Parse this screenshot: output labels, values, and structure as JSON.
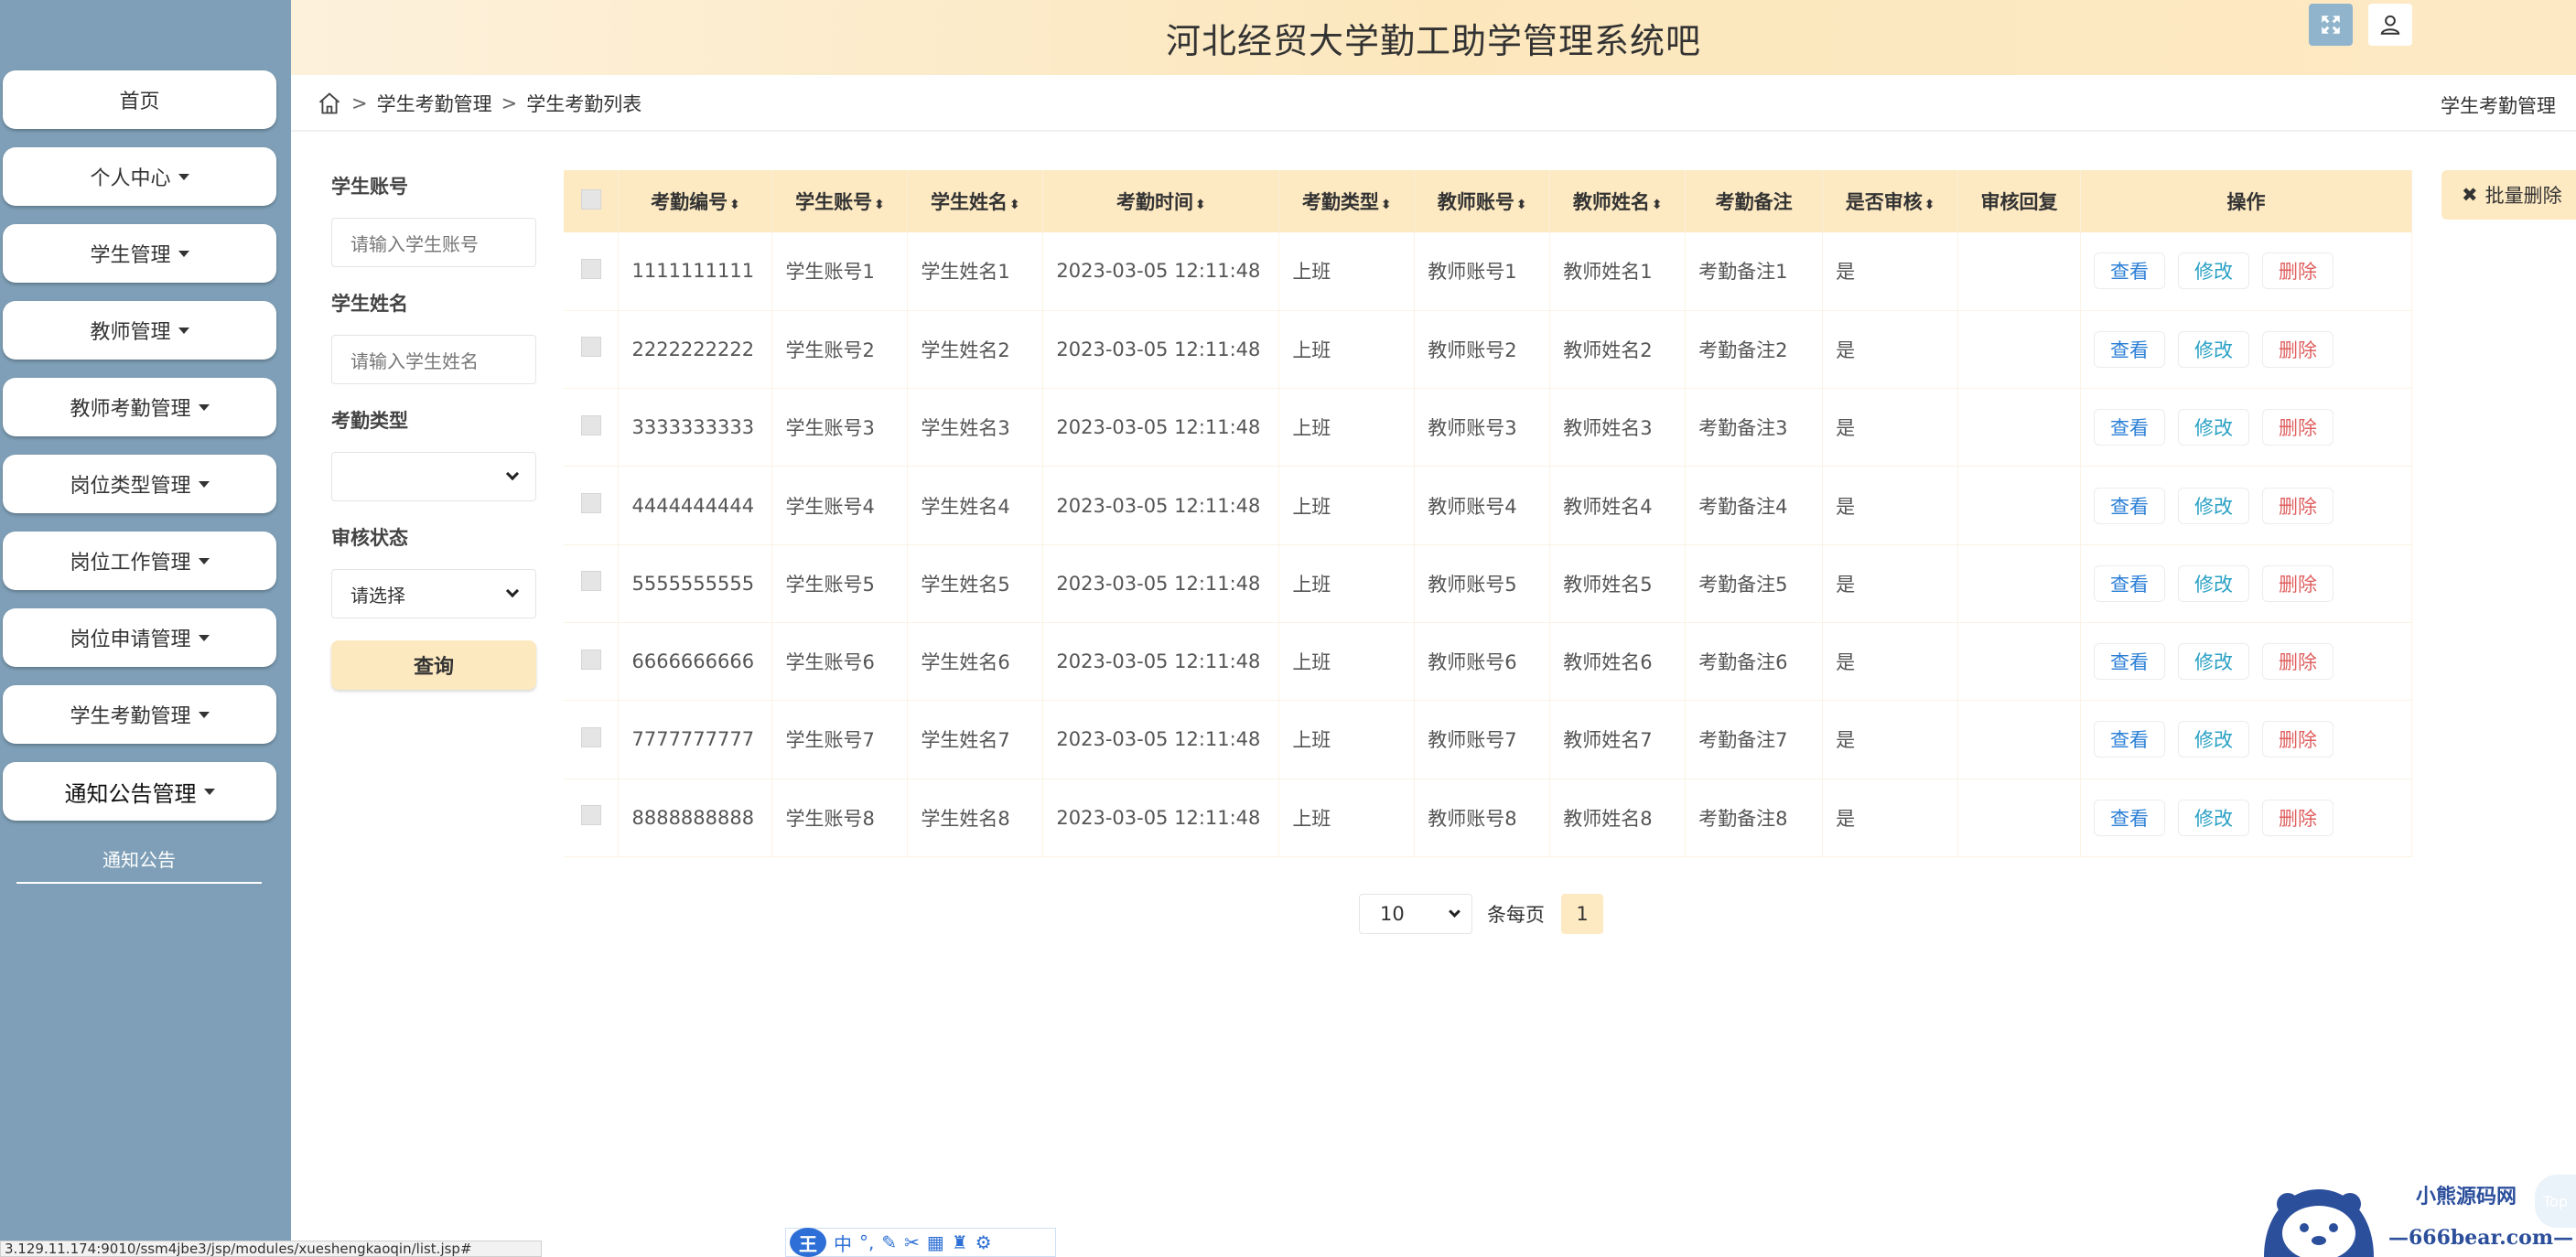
{
  "app_title": "河北经贸大学勤工助学管理系统吧",
  "sidebar": {
    "items": [
      {
        "label": "首页",
        "has_caret": false
      },
      {
        "label": "个人中心",
        "has_caret": true
      },
      {
        "label": "学生管理",
        "has_caret": true
      },
      {
        "label": "教师管理",
        "has_caret": true
      },
      {
        "label": "教师考勤管理",
        "has_caret": true
      },
      {
        "label": "岗位类型管理",
        "has_caret": true
      },
      {
        "label": "岗位工作管理",
        "has_caret": true
      },
      {
        "label": "岗位申请管理",
        "has_caret": true
      },
      {
        "label": "学生考勤管理",
        "has_caret": true
      },
      {
        "label": "通知公告管理",
        "has_caret": true
      }
    ],
    "sub_item": "通知公告",
    "active_index": 9
  },
  "breadcrumb": {
    "separator": ">",
    "items": [
      "学生考勤管理",
      "学生考勤列表"
    ],
    "right_label": "学生考勤管理"
  },
  "search": {
    "student_account_label": "学生账号",
    "student_account_placeholder": "请输入学生账号",
    "student_name_label": "学生姓名",
    "student_name_placeholder": "请输入学生姓名",
    "attendance_type_label": "考勤类型",
    "attendance_type_value": "",
    "review_status_label": "审核状态",
    "review_status_value": "请选择",
    "query_button": "查询"
  },
  "batch_delete_label": "批量删除",
  "table": {
    "columns": [
      "考勤编号",
      "学生账号",
      "学生姓名",
      "考勤时间",
      "考勤类型",
      "教师账号",
      "教师姓名",
      "考勤备注",
      "是否审核",
      "审核回复",
      "操作"
    ],
    "sortable": [
      true,
      true,
      true,
      true,
      true,
      true,
      true,
      false,
      true,
      false,
      false
    ],
    "rows": [
      [
        "1111111111",
        "学生账号1",
        "学生姓名1",
        "2023-03-05 12:11:48",
        "上班",
        "教师账号1",
        "教师姓名1",
        "考勤备注1",
        "是",
        ""
      ],
      [
        "2222222222",
        "学生账号2",
        "学生姓名2",
        "2023-03-05 12:11:48",
        "上班",
        "教师账号2",
        "教师姓名2",
        "考勤备注2",
        "是",
        ""
      ],
      [
        "3333333333",
        "学生账号3",
        "学生姓名3",
        "2023-03-05 12:11:48",
        "上班",
        "教师账号3",
        "教师姓名3",
        "考勤备注3",
        "是",
        ""
      ],
      [
        "4444444444",
        "学生账号4",
        "学生姓名4",
        "2023-03-05 12:11:48",
        "上班",
        "教师账号4",
        "教师姓名4",
        "考勤备注4",
        "是",
        ""
      ],
      [
        "5555555555",
        "学生账号5",
        "学生姓名5",
        "2023-03-05 12:11:48",
        "上班",
        "教师账号5",
        "教师姓名5",
        "考勤备注5",
        "是",
        ""
      ],
      [
        "6666666666",
        "学生账号6",
        "学生姓名6",
        "2023-03-05 12:11:48",
        "上班",
        "教师账号6",
        "教师姓名6",
        "考勤备注6",
        "是",
        ""
      ],
      [
        "7777777777",
        "学生账号7",
        "学生姓名7",
        "2023-03-05 12:11:48",
        "上班",
        "教师账号7",
        "教师姓名7",
        "考勤备注7",
        "是",
        ""
      ],
      [
        "8888888888",
        "学生账号8",
        "学生姓名8",
        "2023-03-05 12:11:48",
        "上班",
        "教师账号8",
        "教师姓名8",
        "考勤备注8",
        "是",
        ""
      ]
    ],
    "actions": {
      "view": "查看",
      "edit": "修改",
      "delete": "删除"
    }
  },
  "pagination": {
    "page_size": "10",
    "per_page_label": "条每页",
    "current_page": "1"
  },
  "status_bar_url": "3.129.11.174:9010/ssm4jbe3/jsp/modules/xueshengkaoqin/list.jsp#",
  "watermark": {
    "line1": "小熊源码网",
    "line2": "—666bear.com—"
  },
  "ime": {
    "logo": "王",
    "mode": "中"
  },
  "to_top_label": "Top",
  "colors": {
    "sidebar_bg": "#7e9fb7",
    "header_bg": "#fce7bd",
    "accent": "#fde9c2",
    "view": "#2b7fd6",
    "edit": "#29a0c4",
    "delete": "#e06060"
  }
}
